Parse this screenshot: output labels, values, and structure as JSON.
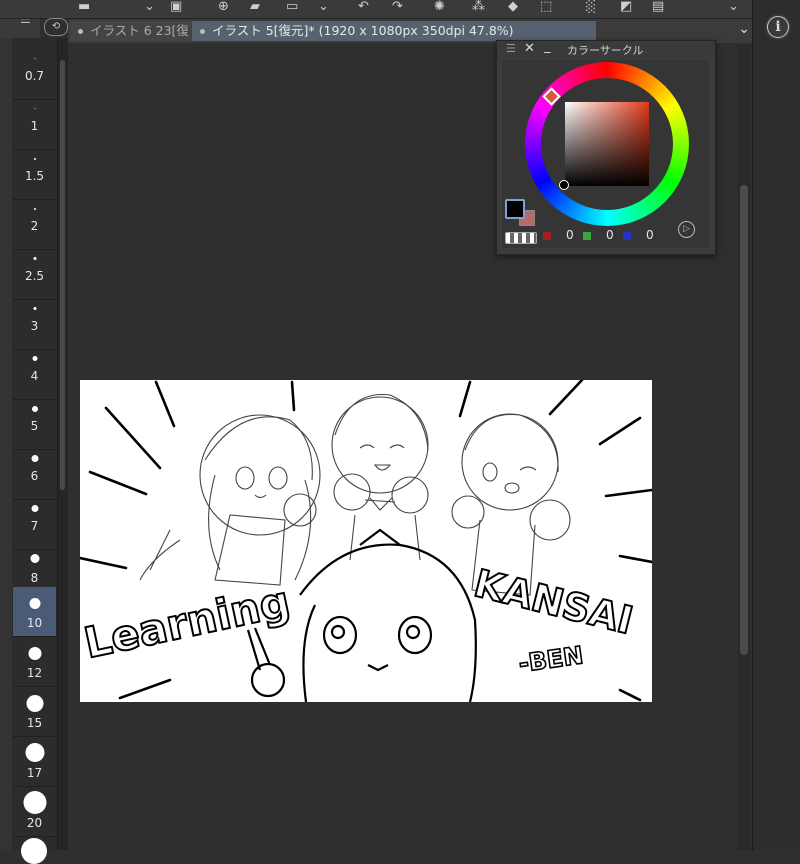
{
  "tabs": [
    {
      "label": "イラスト 6 23[復"
    },
    {
      "label": "イラスト 5[復元]* (1920 x 1080px 350dpi 47.8%)"
    }
  ],
  "color_palette": {
    "title": "カラーサークル",
    "red_value": "0",
    "green_value": "0",
    "blue_value": "0",
    "main_color": "#000000",
    "sub_color": "#b86a6a",
    "hue_color": "#e03a1c"
  },
  "brush_sizes": [
    {
      "label": "0.7"
    },
    {
      "label": "1"
    },
    {
      "label": "1.5"
    },
    {
      "label": "2"
    },
    {
      "label": "2.5"
    },
    {
      "label": "3"
    },
    {
      "label": "4"
    },
    {
      "label": "5"
    },
    {
      "label": "6"
    },
    {
      "label": "7"
    },
    {
      "label": "8"
    },
    {
      "label": "10"
    },
    {
      "label": "12"
    },
    {
      "label": "15"
    },
    {
      "label": "17"
    },
    {
      "label": "20"
    }
  ],
  "artwork": {
    "text_left": "Learning",
    "text_right": "KANSAI",
    "text_sub": "-BEN"
  },
  "colors": {
    "selected_accent": "#4a5b78",
    "active_tab": "#56626f"
  }
}
